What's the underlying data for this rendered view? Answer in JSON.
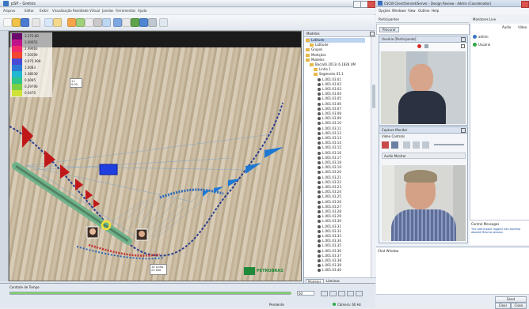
{
  "left_app": {
    "title": "pSP - Gretos",
    "menu": [
      "Arquivo",
      "Editar",
      "Exibir",
      "Visualização",
      "Realidade Virtual",
      "Janelas",
      "Ferramentas",
      "Ajuda"
    ],
    "legend_values": [
      "3.375.60",
      "3.00053",
      "2.99063",
      "7.50590",
      "0.975.999",
      "1.6083",
      "1.08030",
      "0.6085",
      "0.29790",
      "0.0470"
    ],
    "legend_colors": [
      "#6b0a6b",
      "#c0128b",
      "#f02a6a",
      "#f4462f",
      "#4a4ad6",
      "#2b7bd6",
      "#20b8d0",
      "#2fc48b",
      "#7cd044",
      "#cde23a"
    ],
    "viewport_label_1": "11\n0.00",
    "viewport_label_2": "10 Linha\n23 000",
    "brand_text": "PETROBRAS",
    "tree": {
      "header": "Modelos",
      "nodes": [
        {
          "label": "Latitude",
          "level": 1
        },
        {
          "label": "Latitude",
          "level": 2
        },
        {
          "label": "Grupos",
          "level": 1
        },
        {
          "label": "Medições",
          "level": 1
        },
        {
          "label": "Modelos",
          "level": 1
        },
        {
          "label": "Bacia(6.2013) 6.1828 UM",
          "level": 2
        },
        {
          "label": "Linha 1",
          "level": 3
        },
        {
          "label": "Segmento 01.1",
          "level": 3
        },
        {
          "label": "L.001.03.01",
          "level": 4
        },
        {
          "label": "L.001.03.02",
          "level": 4
        },
        {
          "label": "L.001.03.03",
          "level": 4
        },
        {
          "label": "L.001.03.04",
          "level": 4
        },
        {
          "label": "L.001.03.05",
          "level": 4
        },
        {
          "label": "L.001.03.06",
          "level": 4
        },
        {
          "label": "L.001.03.07",
          "level": 4
        },
        {
          "label": "L.001.03.08",
          "level": 4
        },
        {
          "label": "L.001.03.09",
          "level": 4
        },
        {
          "label": "L.001.03.10",
          "level": 4
        },
        {
          "label": "L.001.03.11",
          "level": 4
        },
        {
          "label": "L.001.03.12",
          "level": 4
        },
        {
          "label": "L.001.03.13",
          "level": 4
        },
        {
          "label": "L.001.03.14",
          "level": 4
        },
        {
          "label": "L.001.03.15",
          "level": 4
        },
        {
          "label": "L.001.03.16",
          "level": 4
        },
        {
          "label": "L.001.03.17",
          "level": 4
        },
        {
          "label": "L.001.03.18",
          "level": 4
        },
        {
          "label": "L.001.03.19",
          "level": 4
        },
        {
          "label": "L.001.03.20",
          "level": 4
        },
        {
          "label": "L.001.03.21",
          "level": 4
        },
        {
          "label": "L.001.03.22",
          "level": 4
        },
        {
          "label": "L.001.03.23",
          "level": 4
        },
        {
          "label": "L.001.03.24",
          "level": 4
        },
        {
          "label": "L.001.03.25",
          "level": 4
        },
        {
          "label": "L.001.03.26",
          "level": 4
        },
        {
          "label": "L.001.03.27",
          "level": 4
        },
        {
          "label": "L.001.03.28",
          "level": 4
        },
        {
          "label": "L.001.03.29",
          "level": 4
        },
        {
          "label": "L.001.03.30",
          "level": 4
        },
        {
          "label": "L.001.03.31",
          "level": 4
        },
        {
          "label": "L.001.03.32",
          "level": 4
        },
        {
          "label": "L.001.03.33",
          "level": 4
        },
        {
          "label": "L.001.03.34",
          "level": 4
        },
        {
          "label": "L.001.03.35",
          "level": 4
        },
        {
          "label": "L.001.03.36",
          "level": 4
        },
        {
          "label": "L.001.03.37",
          "level": 4
        },
        {
          "label": "L.001.03.38",
          "level": 4
        },
        {
          "label": "L.001.03.39",
          "level": 4
        },
        {
          "label": "L.001.03.40",
          "level": 4
        }
      ],
      "tabs": [
        "Modelos",
        "Lâminas"
      ]
    },
    "time_panel": {
      "title": "Controle de Tempo",
      "value": "60",
      "status": "Pendente",
      "status_right": "Câmera: 60 Hz"
    }
  },
  "right_app": {
    "title": "CSCW Client/Servlet/Server - Design Review - Admin (Coordenador)",
    "menu": [
      "Opções",
      "Windows",
      "View",
      "Outline",
      "Help"
    ],
    "participants_label": "Participantes",
    "monitors_label": "Monitores Live",
    "search_label": "Procurar",
    "video1_title": "Usuário [Participante]",
    "video2_title": "Capture Monitor",
    "video2_sub": "Video Controls",
    "audio_label": "Audio Monitor",
    "users_headers": [
      "Áudio",
      "Vídeo"
    ],
    "users": [
      {
        "name": "admin",
        "status": "online"
      },
      {
        "name": "Usuário",
        "status": "online"
      }
    ],
    "chat_title": "Control Messages",
    "chat_message": "The participant logged into sistema aboard Mesma session",
    "chat_compose_title": "Chat Window",
    "buttons": [
      "Send",
      "Clear",
      "Close"
    ]
  },
  "colors": {
    "legend_bg": "#ffffff",
    "pipe_green": "#6fb38a",
    "blue_marker": "#1e78d2",
    "red_marker": "#c01818",
    "well_path": "#2c3f8f"
  }
}
